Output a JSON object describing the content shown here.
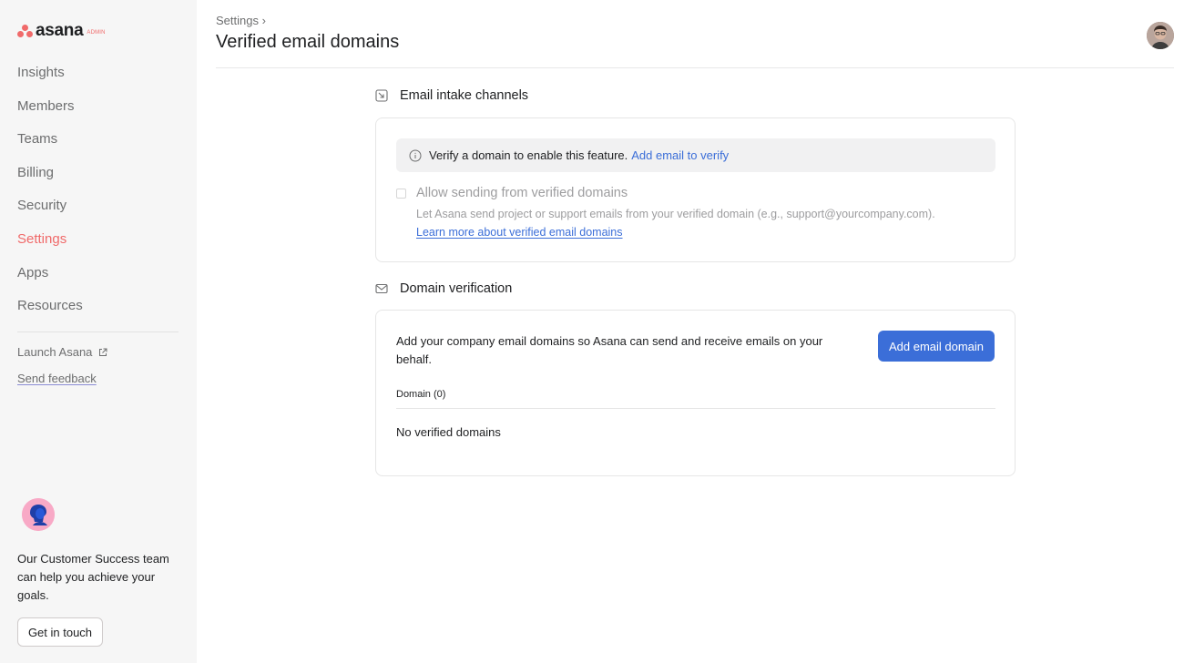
{
  "brand": {
    "name": "asana",
    "badge": "ADMIN",
    "accent_color": "#f06a6a"
  },
  "sidebar": {
    "items": [
      {
        "label": "Insights"
      },
      {
        "label": "Members"
      },
      {
        "label": "Teams"
      },
      {
        "label": "Billing"
      },
      {
        "label": "Security"
      },
      {
        "label": "Settings",
        "active": true
      },
      {
        "label": "Apps"
      },
      {
        "label": "Resources"
      }
    ],
    "launch_label": "Launch Asana",
    "feedback_label": "Send feedback",
    "customer_success": {
      "text": "Our Customer Success team can help you achieve your goals.",
      "button_label": "Get in touch"
    }
  },
  "header": {
    "breadcrumb": "Settings ›",
    "title": "Verified email domains"
  },
  "email_intake": {
    "title": "Email intake channels",
    "banner_text": "Verify a domain to enable this feature.",
    "banner_link": "Add email to verify",
    "checkbox_label": "Allow sending from verified domains",
    "help_text": "Let Asana send project or support emails from your verified domain (e.g., support@yourcompany.com).",
    "learn_more": "Learn more about verified email domains"
  },
  "domain_verification": {
    "title": "Domain verification",
    "description": "Add your company email domains so Asana can send and receive emails on your behalf.",
    "button_label": "Add email domain",
    "column_header": "Domain (0)",
    "empty_text": "No verified domains"
  },
  "colors": {
    "primary_button": "#3b6ed8",
    "link": "#3b6ed8",
    "sidebar_bg": "#f6f6f6"
  }
}
